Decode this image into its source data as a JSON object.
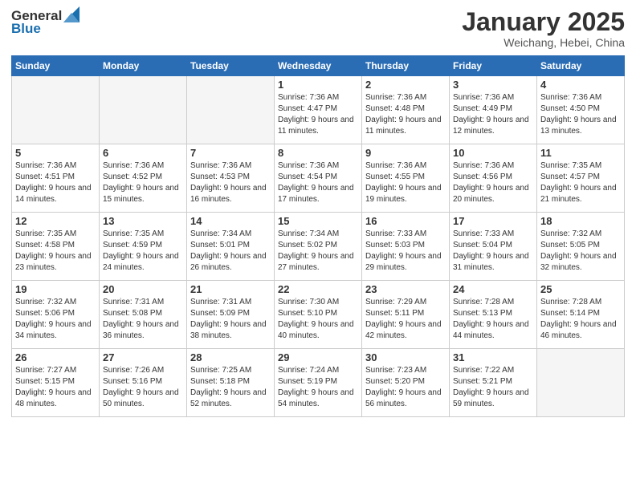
{
  "header": {
    "logo_general": "General",
    "logo_blue": "Blue",
    "month": "January 2025",
    "location": "Weichang, Hebei, China"
  },
  "weekdays": [
    "Sunday",
    "Monday",
    "Tuesday",
    "Wednesday",
    "Thursday",
    "Friday",
    "Saturday"
  ],
  "weeks": [
    [
      {
        "day": "",
        "info": ""
      },
      {
        "day": "",
        "info": ""
      },
      {
        "day": "",
        "info": ""
      },
      {
        "day": "1",
        "info": "Sunrise: 7:36 AM\nSunset: 4:47 PM\nDaylight: 9 hours\nand 11 minutes."
      },
      {
        "day": "2",
        "info": "Sunrise: 7:36 AM\nSunset: 4:48 PM\nDaylight: 9 hours\nand 11 minutes."
      },
      {
        "day": "3",
        "info": "Sunrise: 7:36 AM\nSunset: 4:49 PM\nDaylight: 9 hours\nand 12 minutes."
      },
      {
        "day": "4",
        "info": "Sunrise: 7:36 AM\nSunset: 4:50 PM\nDaylight: 9 hours\nand 13 minutes."
      }
    ],
    [
      {
        "day": "5",
        "info": "Sunrise: 7:36 AM\nSunset: 4:51 PM\nDaylight: 9 hours\nand 14 minutes."
      },
      {
        "day": "6",
        "info": "Sunrise: 7:36 AM\nSunset: 4:52 PM\nDaylight: 9 hours\nand 15 minutes."
      },
      {
        "day": "7",
        "info": "Sunrise: 7:36 AM\nSunset: 4:53 PM\nDaylight: 9 hours\nand 16 minutes."
      },
      {
        "day": "8",
        "info": "Sunrise: 7:36 AM\nSunset: 4:54 PM\nDaylight: 9 hours\nand 17 minutes."
      },
      {
        "day": "9",
        "info": "Sunrise: 7:36 AM\nSunset: 4:55 PM\nDaylight: 9 hours\nand 19 minutes."
      },
      {
        "day": "10",
        "info": "Sunrise: 7:36 AM\nSunset: 4:56 PM\nDaylight: 9 hours\nand 20 minutes."
      },
      {
        "day": "11",
        "info": "Sunrise: 7:35 AM\nSunset: 4:57 PM\nDaylight: 9 hours\nand 21 minutes."
      }
    ],
    [
      {
        "day": "12",
        "info": "Sunrise: 7:35 AM\nSunset: 4:58 PM\nDaylight: 9 hours\nand 23 minutes."
      },
      {
        "day": "13",
        "info": "Sunrise: 7:35 AM\nSunset: 4:59 PM\nDaylight: 9 hours\nand 24 minutes."
      },
      {
        "day": "14",
        "info": "Sunrise: 7:34 AM\nSunset: 5:01 PM\nDaylight: 9 hours\nand 26 minutes."
      },
      {
        "day": "15",
        "info": "Sunrise: 7:34 AM\nSunset: 5:02 PM\nDaylight: 9 hours\nand 27 minutes."
      },
      {
        "day": "16",
        "info": "Sunrise: 7:33 AM\nSunset: 5:03 PM\nDaylight: 9 hours\nand 29 minutes."
      },
      {
        "day": "17",
        "info": "Sunrise: 7:33 AM\nSunset: 5:04 PM\nDaylight: 9 hours\nand 31 minutes."
      },
      {
        "day": "18",
        "info": "Sunrise: 7:32 AM\nSunset: 5:05 PM\nDaylight: 9 hours\nand 32 minutes."
      }
    ],
    [
      {
        "day": "19",
        "info": "Sunrise: 7:32 AM\nSunset: 5:06 PM\nDaylight: 9 hours\nand 34 minutes."
      },
      {
        "day": "20",
        "info": "Sunrise: 7:31 AM\nSunset: 5:08 PM\nDaylight: 9 hours\nand 36 minutes."
      },
      {
        "day": "21",
        "info": "Sunrise: 7:31 AM\nSunset: 5:09 PM\nDaylight: 9 hours\nand 38 minutes."
      },
      {
        "day": "22",
        "info": "Sunrise: 7:30 AM\nSunset: 5:10 PM\nDaylight: 9 hours\nand 40 minutes."
      },
      {
        "day": "23",
        "info": "Sunrise: 7:29 AM\nSunset: 5:11 PM\nDaylight: 9 hours\nand 42 minutes."
      },
      {
        "day": "24",
        "info": "Sunrise: 7:28 AM\nSunset: 5:13 PM\nDaylight: 9 hours\nand 44 minutes."
      },
      {
        "day": "25",
        "info": "Sunrise: 7:28 AM\nSunset: 5:14 PM\nDaylight: 9 hours\nand 46 minutes."
      }
    ],
    [
      {
        "day": "26",
        "info": "Sunrise: 7:27 AM\nSunset: 5:15 PM\nDaylight: 9 hours\nand 48 minutes."
      },
      {
        "day": "27",
        "info": "Sunrise: 7:26 AM\nSunset: 5:16 PM\nDaylight: 9 hours\nand 50 minutes."
      },
      {
        "day": "28",
        "info": "Sunrise: 7:25 AM\nSunset: 5:18 PM\nDaylight: 9 hours\nand 52 minutes."
      },
      {
        "day": "29",
        "info": "Sunrise: 7:24 AM\nSunset: 5:19 PM\nDaylight: 9 hours\nand 54 minutes."
      },
      {
        "day": "30",
        "info": "Sunrise: 7:23 AM\nSunset: 5:20 PM\nDaylight: 9 hours\nand 56 minutes."
      },
      {
        "day": "31",
        "info": "Sunrise: 7:22 AM\nSunset: 5:21 PM\nDaylight: 9 hours\nand 59 minutes."
      },
      {
        "day": "",
        "info": ""
      }
    ]
  ]
}
